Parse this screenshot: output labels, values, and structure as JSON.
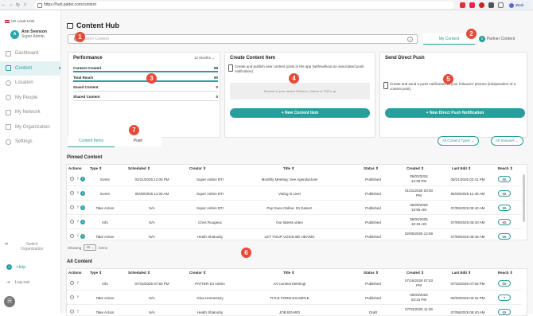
{
  "browser": {
    "url": "https://hub.patter.com/content",
    "profile": "Work"
  },
  "sidebar": {
    "org": "US Local 1234",
    "user_initial": "A",
    "user_name": "Ann Svenson",
    "user_role": "Super Admin",
    "items": [
      {
        "label": "Dashboard"
      },
      {
        "label": "Content"
      },
      {
        "label": "Location"
      },
      {
        "label": "My People"
      },
      {
        "label": "My Network"
      },
      {
        "label": "My Organization"
      },
      {
        "label": "Settings"
      }
    ],
    "switch_label_1": "Switch",
    "switch_label_2": "Organization",
    "help": "Help",
    "help_icon": "?",
    "logout": "Log out",
    "menu_icon": "☰"
  },
  "page": {
    "title": "Content Hub",
    "search_placeholder": "Search Content",
    "clear_icon": "x"
  },
  "segment": {
    "my": "My Content",
    "partner": "Partner Content"
  },
  "performance": {
    "title": "Performance",
    "period": "12 Months ⌄",
    "rows": [
      {
        "label": "Content Created",
        "value": "68"
      },
      {
        "label": "Total Reach",
        "value": "50"
      },
      {
        "label": "Saved Content",
        "value": "0"
      },
      {
        "label": "Shared Content",
        "value": "0"
      }
    ]
  },
  "create": {
    "title": "Create Content Item",
    "desc": "Create and publish new content posts in the app (with/without an associated push notification).",
    "drop": "Browse in your device Pictures, Videos or PDFs",
    "button": "+  New Content Item"
  },
  "push": {
    "title": "Send Direct Push",
    "desc": "Create and send a push notification to your followers' phones (independent of a content post).",
    "button": "+  New Direct Push Notification"
  },
  "tabs": {
    "items": "Content Items",
    "push": "Push"
  },
  "filters": {
    "types": "All Content Types  ⌄",
    "statuses": "All Statuses  ⌄"
  },
  "pinned": {
    "title": "Pinned Content",
    "headers": [
      "Actions",
      "Type  ⇕",
      "Scheduled  ⇕",
      "Creator  ⇕",
      "Title  ⇕",
      "Status  ⇕",
      "Created  ⇕",
      "Last Edit  ⇕",
      "Reach  ⇕"
    ],
    "rows": [
      {
        "n": "1",
        "type": "Event",
        "scheduled": "02/21/2025 12:00 PM",
        "creator": "Super Admin BTI",
        "title": "Monthly Meeting: See Agenda/Join!",
        "status": "Published",
        "created1": "06/03/2024",
        "created2": "12:39 PM",
        "edit": "05/21/2025 02:41 PM",
        "reach": "65"
      },
      {
        "n": "2",
        "type": "Event",
        "scheduled": "05/30/2025 11:00 AM",
        "creator": "Super Admin BTI",
        "title": "Voting Is Live!",
        "status": "Published",
        "created1": "01/31/2025 03:00",
        "created2": "PM",
        "edit": "05/30/2025 11:48 AM",
        "reach": "65"
      },
      {
        "n": "3",
        "type": "Take Action",
        "scheduled": "N/A",
        "creator": "Super Admin BTI",
        "title": "Pay Dues Online: It's Easier!",
        "status": "Published",
        "created1": "05/29/2025",
        "created2": "10:56 AM",
        "edit": "07/09/2025 08:40 AM",
        "reach": "65"
      },
      {
        "n": "4",
        "type": "Info",
        "scheduled": "N/A",
        "creator": "Chris Rougeux",
        "title": "Our latests video",
        "status": "Published",
        "created1": "06/04/2025",
        "created2": "10:33 AM",
        "edit": "07/09/2025 08:40 AM",
        "reach": "65"
      },
      {
        "n": "5",
        "type": "Take Action",
        "scheduled": "N/A",
        "creator": "Heath Shatouby",
        "title": "LET YOUR VOICE BE HEARD!",
        "status": "Published",
        "created1": "02/05/2025 12:59",
        "created2": "",
        "edit": "07/09/2025 08:40 AM",
        "reach": "65"
      }
    ],
    "showing_label": "Showing",
    "showing_count": "10 ⌄",
    "showing_items": "items"
  },
  "all": {
    "title": "All Content",
    "rows": [
      {
        "type": "Info",
        "scheduled": "07/15/2025 07:50 PM",
        "creator": "PATTER DJ Admin",
        "title": "Art Contest Meeting!",
        "status": "Published",
        "created1": "07/15/2025 07:53",
        "created2": "PM",
        "edit": "07/15/2025 07:53 PM",
        "reach": "65"
      },
      {
        "type": "Take Action",
        "scheduled": "N/A",
        "creator": "Gina Hennessey",
        "title": "TITLE FORM EXAMPLE",
        "status": "Published",
        "created1": "06/03/2025",
        "created2": "03:15 PM",
        "edit": "06/03/2025 03:15 PM",
        "reach": "7"
      },
      {
        "type": "Take Action",
        "scheduled": "N/A",
        "creator": "Heath Shatouby",
        "title": "JOB BOARD",
        "status": "Draft",
        "created1": "07/03/2025 11:29",
        "created2": "",
        "edit": "07/09/2025 08:40 AM",
        "reach": "65"
      }
    ]
  },
  "badges": [
    "1",
    "2",
    "3",
    "4",
    "5",
    "6",
    "7"
  ]
}
